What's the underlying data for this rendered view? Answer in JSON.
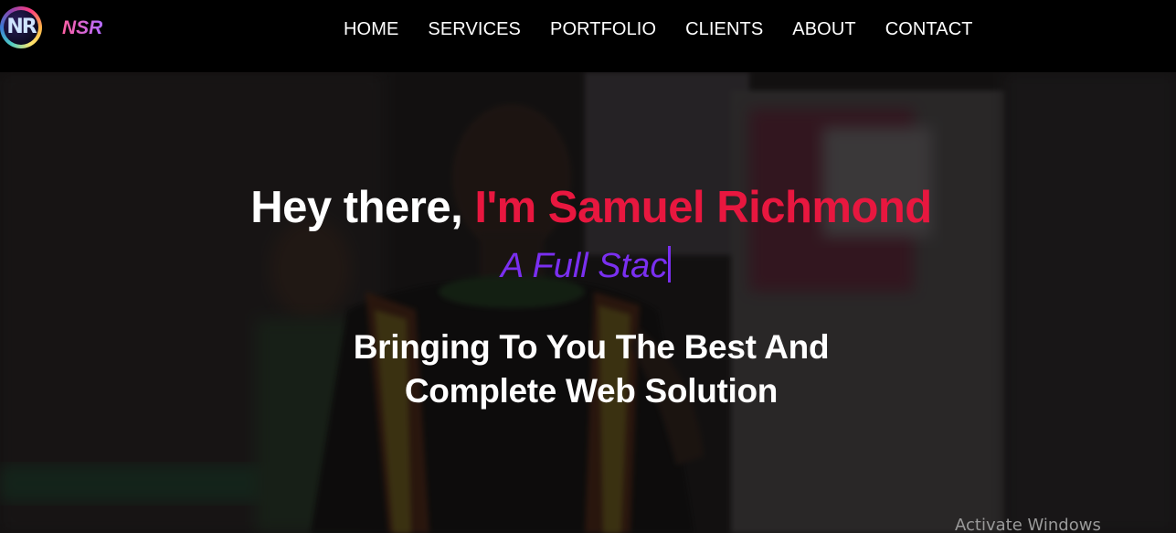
{
  "brand": {
    "logo_text": "NR",
    "name": "NSR"
  },
  "nav": {
    "items": [
      {
        "label": "HOME"
      },
      {
        "label": "SERVICES"
      },
      {
        "label": "PORTFOLIO"
      },
      {
        "label": "CLIENTS"
      },
      {
        "label": "ABOUT"
      },
      {
        "label": "CONTACT"
      }
    ]
  },
  "hero": {
    "intro": "Hey there, ",
    "name": "I'm Samuel Richmond",
    "typed_text": "A Full Stac",
    "tagline_line1": "Bringing To You The Best And",
    "tagline_line2": "Complete Web Solution"
  },
  "os_watermark": "Activate Windows",
  "colors": {
    "accent_name": "#e8173f",
    "accent_typed": "#7a2ff0",
    "navbar_bg": "#000000",
    "brand_gradient_start": "#ff5fa2",
    "brand_gradient_end": "#b46bff"
  },
  "icons": {
    "logo": "nsr-logo-icon",
    "cursor": "text-cursor-icon"
  }
}
